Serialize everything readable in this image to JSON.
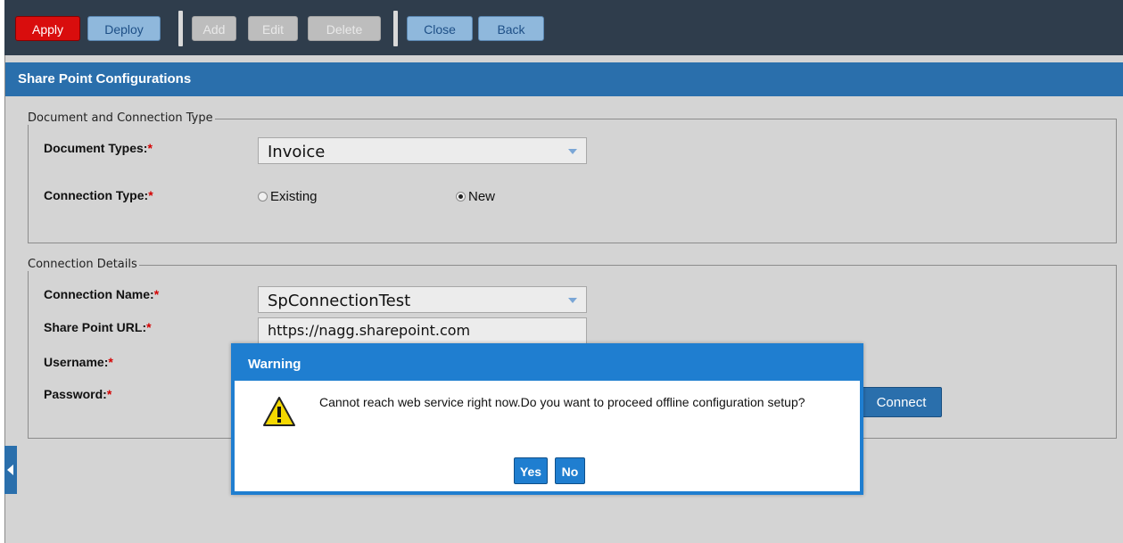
{
  "toolbar": {
    "apply": "Apply",
    "deploy": "Deploy",
    "add": "Add",
    "edit": "Edit",
    "delete": "Delete",
    "close": "Close",
    "back": "Back"
  },
  "page": {
    "title": "Share Point Configurations"
  },
  "document_section": {
    "legend": "Document and Connection Type",
    "document_types_label": "Document Types:",
    "document_types_value": "Invoice",
    "connection_type_label": "Connection Type:",
    "options": [
      {
        "label": "Existing",
        "selected": false
      },
      {
        "label": "New",
        "selected": true
      }
    ]
  },
  "connection_section": {
    "legend": "Connection Details",
    "connection_name_label": "Connection Name:",
    "connection_name_value": "SpConnectionTest",
    "url_label": "Share Point URL:",
    "url_value": "https://nagg.sharepoint.com",
    "username_label": "Username:",
    "password_label": "Password:",
    "connect_label": "Connect"
  },
  "required_marker": "*",
  "dialog": {
    "title": "Warning",
    "message": "Cannot reach web service right now.Do you want to proceed offline configuration setup?",
    "yes": "Yes",
    "no": "No",
    "icon": "warning-icon"
  },
  "colors": {
    "toolbar_bg": "#2f3d4c",
    "header_bg": "#2a6fac",
    "apply_red": "#d90d0d",
    "dialog_blue": "#1f7ed0",
    "required_red": "#d40000"
  }
}
